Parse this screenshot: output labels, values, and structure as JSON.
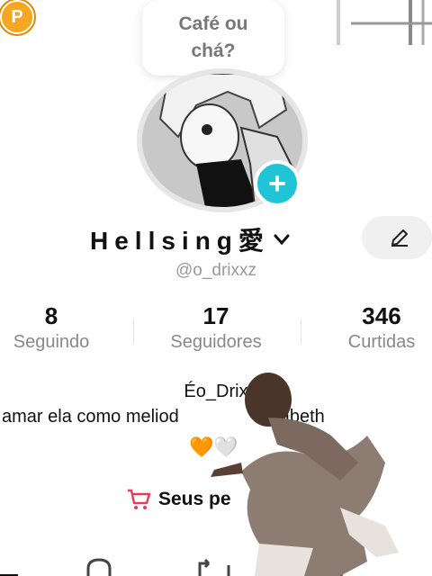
{
  "top": {
    "coin_letter": "P"
  },
  "bubble": {
    "line1": "Café ou",
    "line2": "chá?"
  },
  "profile": {
    "display_name": "Hellsing愛",
    "chevron": "⌄",
    "handle": "@o_drixxz"
  },
  "stats": [
    {
      "value": "8",
      "label": "Seguindo"
    },
    {
      "value": "17",
      "label": "Seguidores"
    },
    {
      "value": "346",
      "label": "Curtidas"
    }
  ],
  "bio": {
    "name": "Éo_Drix",
    "text_left": "i amar ela como meliod",
    "text_right": "zabeth",
    "hearts": "🧡🤍"
  },
  "shop": {
    "label": "Seus pe",
    "label_suffix": "s"
  },
  "colors": {
    "accent": "#20c4d6",
    "shop": "#e63b5c",
    "coin": "#f5a623"
  },
  "icons": [
    "plus-icon",
    "pencil-icon",
    "cart-icon",
    "lock-icon",
    "repost-icon",
    "bookmark-icon"
  ]
}
